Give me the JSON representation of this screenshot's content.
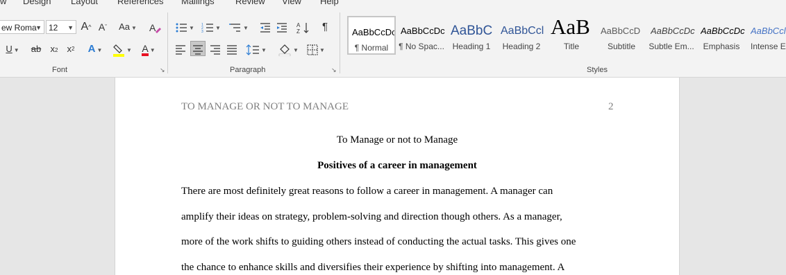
{
  "ribbon": {
    "tabs": [
      "w",
      "Design",
      "Layout",
      "References",
      "Mailings",
      "Review",
      "View",
      "Help"
    ],
    "font_group": {
      "label": "Font",
      "font_name": "ew Roma",
      "font_size": "12",
      "grow": "A",
      "shrink": "A",
      "change_case": "Aa",
      "underline": "U",
      "strike": "ab",
      "subscript": "x",
      "superscript": "x",
      "text_effects": "A",
      "font_color": "A",
      "highlight_color": "#ffff00",
      "font_color_value": "#e81123"
    },
    "paragraph_group": {
      "label": "Paragraph"
    },
    "styles_group": {
      "label": "Styles",
      "items": [
        {
          "preview": "AaBbCcDc",
          "name": "¶ Normal"
        },
        {
          "preview": "AaBbCcDc",
          "name": "¶ No Spac..."
        },
        {
          "preview": "AaBbC",
          "name": "Heading 1"
        },
        {
          "preview": "AaBbCcl",
          "name": "Heading 2"
        },
        {
          "preview": "AaB",
          "name": "Title"
        },
        {
          "preview": "AaBbCcD",
          "name": "Subtitle"
        },
        {
          "preview": "AaBbCcDc",
          "name": "Subtle Em..."
        },
        {
          "preview": "AaBbCcDc",
          "name": "Emphasis"
        },
        {
          "preview": "AaBbCcl",
          "name": "Intense E"
        }
      ]
    }
  },
  "document": {
    "header": "TO MANAGE OR NOT TO MANAGE",
    "page_number": "2",
    "title": "To Manage or not to Manage",
    "heading": "Positives of a career in management",
    "lines": [
      "There are most definitely great reasons to follow a career in management. A manager can",
      "amplify their ideas on strategy, problem-solving and direction though others. As a manager,",
      "more of the work shifts to guiding others instead of conducting the actual tasks. This gives one",
      "the chance to enhance skills and diversifies their experience by shifting into management. A"
    ]
  }
}
